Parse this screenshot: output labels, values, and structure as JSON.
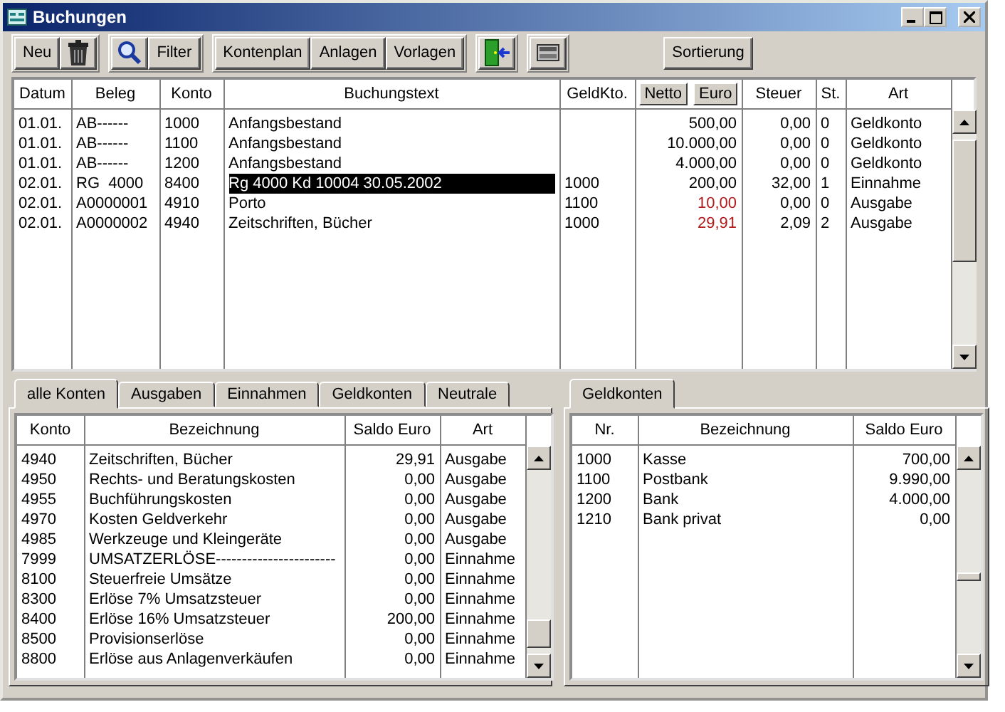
{
  "window": {
    "title": "Buchungen"
  },
  "toolbar": {
    "buttons": [
      "Neu",
      "Filter",
      "Kontenplan",
      "Anlagen",
      "Vorlagen",
      "Sortierung"
    ]
  },
  "bookings": {
    "columns": [
      "Datum",
      "Beleg",
      "Konto",
      "Buchungstext",
      "GeldKto.",
      "Steuer",
      "St.",
      "Art"
    ],
    "amount_header_buttons": [
      "Netto",
      "Euro"
    ],
    "rows": [
      {
        "datum": "01.01.",
        "beleg": "AB------",
        "konto": "1000",
        "text": "Anfangsbestand",
        "geldkto": "",
        "betrag": "500,00",
        "steuer": "0,00",
        "st": "0",
        "art": "Geldkonto",
        "color": "#000000",
        "selected": false
      },
      {
        "datum": "01.01.",
        "beleg": "AB------",
        "konto": "1100",
        "text": "Anfangsbestand",
        "geldkto": "",
        "betrag": "10.000,00",
        "steuer": "0,00",
        "st": "0",
        "art": "Geldkonto",
        "color": "#000000",
        "selected": false
      },
      {
        "datum": "01.01.",
        "beleg": "AB------",
        "konto": "1200",
        "text": "Anfangsbestand",
        "geldkto": "",
        "betrag": "4.000,00",
        "steuer": "0,00",
        "st": "0",
        "art": "Geldkonto",
        "color": "#000000",
        "selected": false
      },
      {
        "datum": "02.01.",
        "beleg": "RG  4000",
        "konto": "8400",
        "text": "Rg 4000 Kd 10004 30.05.2002",
        "geldkto": "1000",
        "betrag": "200,00",
        "steuer": "32,00",
        "st": "1",
        "art": "Einnahme",
        "color": "#000000",
        "selected": true
      },
      {
        "datum": "02.01.",
        "beleg": "A0000001",
        "konto": "4910",
        "text": "Porto",
        "geldkto": "1100",
        "betrag": "10,00",
        "steuer": "0,00",
        "st": "0",
        "art": "Ausgabe",
        "color": "#b01c1c",
        "selected": false
      },
      {
        "datum": "02.01.",
        "beleg": "A0000002",
        "konto": "4940",
        "text": "Zeitschriften, Bücher",
        "geldkto": "1000",
        "betrag": "29,91",
        "steuer": "2,09",
        "st": "2",
        "art": "Ausgabe",
        "color": "#b01c1c",
        "selected": false
      }
    ]
  },
  "accounts_panel": {
    "tabs": [
      {
        "label": "alle Konten",
        "selected": true
      },
      {
        "label": "Ausgaben",
        "selected": false
      },
      {
        "label": "Einnahmen",
        "selected": false
      },
      {
        "label": "Geldkonten",
        "selected": false
      },
      {
        "label": "Neutrale",
        "selected": false
      }
    ],
    "columns": [
      "Konto",
      "Bezeichnung",
      "Saldo Euro",
      "Art"
    ],
    "rows": [
      [
        "4940",
        "Zeitschriften, Bücher",
        "29,91",
        "Ausgabe"
      ],
      [
        "4950",
        "Rechts- und Beratungskosten",
        "0,00",
        "Ausgabe"
      ],
      [
        "4955",
        "Buchführungskosten",
        "0,00",
        "Ausgabe"
      ],
      [
        "4970",
        "Kosten Geldverkehr",
        "0,00",
        "Ausgabe"
      ],
      [
        "4985",
        "Werkzeuge und Kleingeräte",
        "0,00",
        "Ausgabe"
      ],
      [
        "7999",
        "UMSATZERLÖSE-----------------------",
        "0,00",
        "Einnahme"
      ],
      [
        "8100",
        "Steuerfreie Umsätze",
        "0,00",
        "Einnahme"
      ],
      [
        "8300",
        "Erlöse 7% Umsatzsteuer",
        "0,00",
        "Einnahme"
      ],
      [
        "8400",
        "Erlöse 16% Umsatzsteuer",
        "200,00",
        "Einnahme"
      ],
      [
        "8500",
        "Provisionserlöse",
        "0,00",
        "Einnahme"
      ],
      [
        "8800",
        "Erlöse aus Anlagenverkäufen",
        "0,00",
        "Einnahme"
      ]
    ]
  },
  "money_panel": {
    "tabs": [
      {
        "label": "Geldkonten",
        "selected": true
      }
    ],
    "columns": [
      "Nr.",
      "Bezeichnung",
      "Saldo Euro"
    ],
    "rows": [
      [
        "1000",
        "Kasse",
        "700,00"
      ],
      [
        "1100",
        "Postbank",
        "9.990,00"
      ],
      [
        "1200",
        "Bank",
        "4.000,00"
      ],
      [
        "1210",
        "Bank privat",
        "0,00"
      ]
    ]
  }
}
